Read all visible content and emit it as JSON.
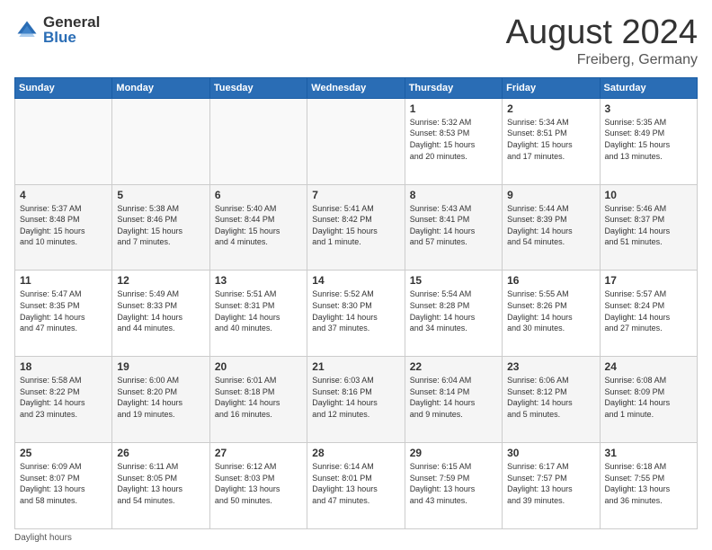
{
  "header": {
    "logo_general": "General",
    "logo_blue": "Blue",
    "month": "August 2024",
    "location": "Freiberg, Germany"
  },
  "days_of_week": [
    "Sunday",
    "Monday",
    "Tuesday",
    "Wednesday",
    "Thursday",
    "Friday",
    "Saturday"
  ],
  "weeks": [
    [
      {
        "day": "",
        "info": ""
      },
      {
        "day": "",
        "info": ""
      },
      {
        "day": "",
        "info": ""
      },
      {
        "day": "",
        "info": ""
      },
      {
        "day": "1",
        "info": "Sunrise: 5:32 AM\nSunset: 8:53 PM\nDaylight: 15 hours\nand 20 minutes."
      },
      {
        "day": "2",
        "info": "Sunrise: 5:34 AM\nSunset: 8:51 PM\nDaylight: 15 hours\nand 17 minutes."
      },
      {
        "day": "3",
        "info": "Sunrise: 5:35 AM\nSunset: 8:49 PM\nDaylight: 15 hours\nand 13 minutes."
      }
    ],
    [
      {
        "day": "4",
        "info": "Sunrise: 5:37 AM\nSunset: 8:48 PM\nDaylight: 15 hours\nand 10 minutes."
      },
      {
        "day": "5",
        "info": "Sunrise: 5:38 AM\nSunset: 8:46 PM\nDaylight: 15 hours\nand 7 minutes."
      },
      {
        "day": "6",
        "info": "Sunrise: 5:40 AM\nSunset: 8:44 PM\nDaylight: 15 hours\nand 4 minutes."
      },
      {
        "day": "7",
        "info": "Sunrise: 5:41 AM\nSunset: 8:42 PM\nDaylight: 15 hours\nand 1 minute."
      },
      {
        "day": "8",
        "info": "Sunrise: 5:43 AM\nSunset: 8:41 PM\nDaylight: 14 hours\nand 57 minutes."
      },
      {
        "day": "9",
        "info": "Sunrise: 5:44 AM\nSunset: 8:39 PM\nDaylight: 14 hours\nand 54 minutes."
      },
      {
        "day": "10",
        "info": "Sunrise: 5:46 AM\nSunset: 8:37 PM\nDaylight: 14 hours\nand 51 minutes."
      }
    ],
    [
      {
        "day": "11",
        "info": "Sunrise: 5:47 AM\nSunset: 8:35 PM\nDaylight: 14 hours\nand 47 minutes."
      },
      {
        "day": "12",
        "info": "Sunrise: 5:49 AM\nSunset: 8:33 PM\nDaylight: 14 hours\nand 44 minutes."
      },
      {
        "day": "13",
        "info": "Sunrise: 5:51 AM\nSunset: 8:31 PM\nDaylight: 14 hours\nand 40 minutes."
      },
      {
        "day": "14",
        "info": "Sunrise: 5:52 AM\nSunset: 8:30 PM\nDaylight: 14 hours\nand 37 minutes."
      },
      {
        "day": "15",
        "info": "Sunrise: 5:54 AM\nSunset: 8:28 PM\nDaylight: 14 hours\nand 34 minutes."
      },
      {
        "day": "16",
        "info": "Sunrise: 5:55 AM\nSunset: 8:26 PM\nDaylight: 14 hours\nand 30 minutes."
      },
      {
        "day": "17",
        "info": "Sunrise: 5:57 AM\nSunset: 8:24 PM\nDaylight: 14 hours\nand 27 minutes."
      }
    ],
    [
      {
        "day": "18",
        "info": "Sunrise: 5:58 AM\nSunset: 8:22 PM\nDaylight: 14 hours\nand 23 minutes."
      },
      {
        "day": "19",
        "info": "Sunrise: 6:00 AM\nSunset: 8:20 PM\nDaylight: 14 hours\nand 19 minutes."
      },
      {
        "day": "20",
        "info": "Sunrise: 6:01 AM\nSunset: 8:18 PM\nDaylight: 14 hours\nand 16 minutes."
      },
      {
        "day": "21",
        "info": "Sunrise: 6:03 AM\nSunset: 8:16 PM\nDaylight: 14 hours\nand 12 minutes."
      },
      {
        "day": "22",
        "info": "Sunrise: 6:04 AM\nSunset: 8:14 PM\nDaylight: 14 hours\nand 9 minutes."
      },
      {
        "day": "23",
        "info": "Sunrise: 6:06 AM\nSunset: 8:12 PM\nDaylight: 14 hours\nand 5 minutes."
      },
      {
        "day": "24",
        "info": "Sunrise: 6:08 AM\nSunset: 8:09 PM\nDaylight: 14 hours\nand 1 minute."
      }
    ],
    [
      {
        "day": "25",
        "info": "Sunrise: 6:09 AM\nSunset: 8:07 PM\nDaylight: 13 hours\nand 58 minutes."
      },
      {
        "day": "26",
        "info": "Sunrise: 6:11 AM\nSunset: 8:05 PM\nDaylight: 13 hours\nand 54 minutes."
      },
      {
        "day": "27",
        "info": "Sunrise: 6:12 AM\nSunset: 8:03 PM\nDaylight: 13 hours\nand 50 minutes."
      },
      {
        "day": "28",
        "info": "Sunrise: 6:14 AM\nSunset: 8:01 PM\nDaylight: 13 hours\nand 47 minutes."
      },
      {
        "day": "29",
        "info": "Sunrise: 6:15 AM\nSunset: 7:59 PM\nDaylight: 13 hours\nand 43 minutes."
      },
      {
        "day": "30",
        "info": "Sunrise: 6:17 AM\nSunset: 7:57 PM\nDaylight: 13 hours\nand 39 minutes."
      },
      {
        "day": "31",
        "info": "Sunrise: 6:18 AM\nSunset: 7:55 PM\nDaylight: 13 hours\nand 36 minutes."
      }
    ]
  ],
  "footer": {
    "note": "Daylight hours"
  }
}
